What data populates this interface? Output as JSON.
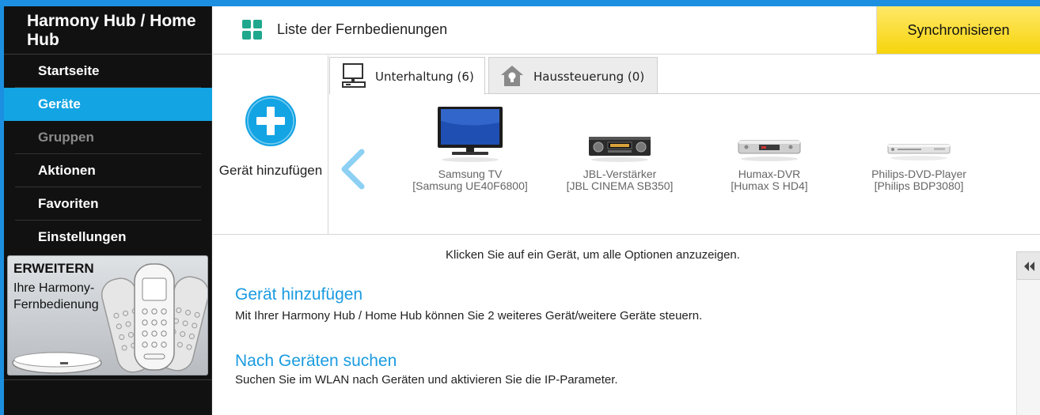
{
  "app": {
    "title": "Harmony Hub / Home Hub"
  },
  "sidebar": {
    "items": [
      {
        "label": "Startseite"
      },
      {
        "label": "Geräte"
      },
      {
        "label": "Gruppen"
      },
      {
        "label": "Aktionen"
      },
      {
        "label": "Favoriten"
      },
      {
        "label": "Einstellungen"
      }
    ],
    "promo": {
      "title": "ERWEITERN",
      "text": "Ihre Harmony-Fernbedienung"
    }
  },
  "header": {
    "title": "Liste der Fernbedienungen",
    "sync_label": "Synchronisieren"
  },
  "add_device": {
    "label": "Gerät hinzufügen"
  },
  "tabs": [
    {
      "label": "Unterhaltung (6)",
      "icon": "monitor-icon",
      "active": true
    },
    {
      "label": "Haussteuerung (0)",
      "icon": "house-icon",
      "active": false
    }
  ],
  "devices": [
    {
      "name": "Samsung TV",
      "model": "[Samsung UE40F6800]",
      "icon": "tv-icon"
    },
    {
      "name": "JBL-Verstärker",
      "model": "[JBL CINEMA SB350]",
      "icon": "amplifier-icon"
    },
    {
      "name": "Humax-DVR",
      "model": "[Humax S HD4]",
      "icon": "dvr-icon"
    },
    {
      "name": "Philips-DVD-Player",
      "model": "[Philips BDP3080]",
      "icon": "dvd-player-icon"
    }
  ],
  "info": "Klicken Sie auf ein Gerät, um alle Optionen anzuzeigen.",
  "sections": [
    {
      "heading": "Gerät hinzufügen",
      "text": "Mit Ihrer Harmony Hub / Home Hub  können Sie 2 weiteres Gerät/weitere Geräte steuern."
    },
    {
      "heading": "Nach Geräten suchen",
      "text": "Suchen Sie im WLAN nach Geräten und aktivieren Sie die IP-Parameter."
    }
  ],
  "colors": {
    "accent": "#13a4e3",
    "sync": "#f6d40c",
    "link": "#1a9be0",
    "sidebar": "#111111"
  }
}
